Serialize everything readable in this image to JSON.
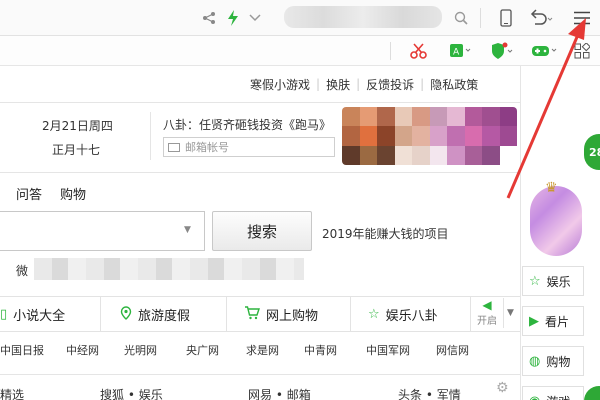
{
  "toolbar": {
    "share_icon": "share-icon",
    "bolt_icon": "lightning-icon",
    "chevron_icon": "chevron-down-icon",
    "search_icon": "search-icon",
    "phone_icon": "phone-icon",
    "undo_icon": "undo-icon",
    "menu_icon": "menu-icon"
  },
  "extensions": [
    "scissors-icon",
    "translate-icon",
    "shield-icon",
    "gamepad-icon",
    "apps-icon"
  ],
  "header_links": [
    "寒假小游戏",
    "换肤",
    "反馈投诉",
    "隐私政策"
  ],
  "date": {
    "solar": "2月21日周四",
    "lunar": "正月十七"
  },
  "gossip_text": "八卦：任贤齐砸钱投资《跑马》",
  "mail_placeholder": "邮箱帐号",
  "search": {
    "tabs": [
      "问答",
      "购物"
    ],
    "button": "搜索",
    "ad_text": "2019年能赚大钱的项目",
    "weixin_label": "微"
  },
  "categories": [
    "小说大全",
    "旅游度假",
    "网上购物",
    "娱乐八卦"
  ],
  "sound_label": "开启",
  "sites": [
    "中国日报",
    "中经网",
    "光明网",
    "央广网",
    "求是网",
    "中青网",
    "中国军网",
    "网信网"
  ],
  "bottom_links": [
    "精选",
    "搜狐 • 娱乐",
    "网易 • 邮箱",
    "头条 • 军情"
  ],
  "sidebar": {
    "badge": "28",
    "buttons": [
      "娱乐",
      "看片",
      "购物",
      "游戏"
    ]
  },
  "colors": {
    "accent_green": "#2db43e",
    "arrow_red": "#e53935"
  }
}
